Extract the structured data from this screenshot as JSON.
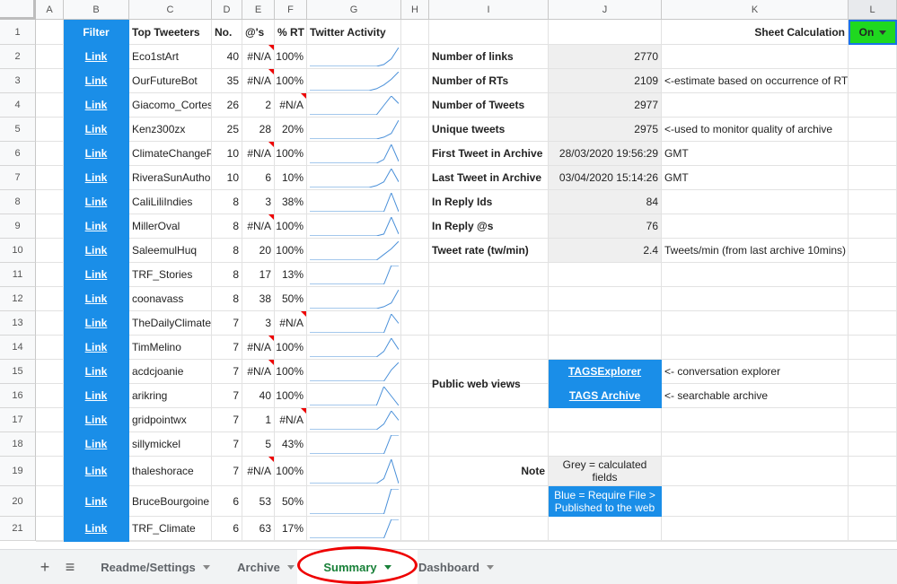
{
  "columns": [
    "A",
    "B",
    "C",
    "D",
    "E",
    "F",
    "G",
    "H",
    "I",
    "J",
    "K",
    "L"
  ],
  "rows": [
    "1",
    "2",
    "3",
    "4",
    "5",
    "6",
    "7",
    "8",
    "9",
    "10",
    "11",
    "12",
    "13",
    "14",
    "15",
    "16",
    "17",
    "18",
    "19",
    "20",
    "21"
  ],
  "header": {
    "filter": "Filter",
    "top_tweeters": "Top Tweeters",
    "no": "No.",
    "ats": "@'s",
    "pct_rt": "% RT",
    "activity": "Twitter Activity",
    "sheet_calc": "Sheet Calculation",
    "sheet_calc_value": "On"
  },
  "tweeters": [
    {
      "link": "Link",
      "name": "Eco1stArt",
      "no": "40",
      "ats": "#N/A",
      "rt": "100%",
      "ats_flag": true,
      "rt_flag": false
    },
    {
      "link": "Link",
      "name": "OurFutureBot",
      "no": "35",
      "ats": "#N/A",
      "rt": "100%",
      "ats_flag": true,
      "rt_flag": false
    },
    {
      "link": "Link",
      "name": "Giacomo_Cortes",
      "no": "26",
      "ats": "2",
      "rt": "#N/A",
      "ats_flag": false,
      "rt_flag": true
    },
    {
      "link": "Link",
      "name": "Kenz300zx",
      "no": "25",
      "ats": "28",
      "rt": "20%",
      "ats_flag": false,
      "rt_flag": false
    },
    {
      "link": "Link",
      "name": "ClimateChangePa",
      "no": "10",
      "ats": "#N/A",
      "rt": "100%",
      "ats_flag": true,
      "rt_flag": false
    },
    {
      "link": "Link",
      "name": "RiveraSunAuthor",
      "no": "10",
      "ats": "6",
      "rt": "10%",
      "ats_flag": false,
      "rt_flag": false
    },
    {
      "link": "Link",
      "name": "CaliLiliIndies",
      "no": "8",
      "ats": "3",
      "rt": "38%",
      "ats_flag": false,
      "rt_flag": false
    },
    {
      "link": "Link",
      "name": "MillerOval",
      "no": "8",
      "ats": "#N/A",
      "rt": "100%",
      "ats_flag": true,
      "rt_flag": false
    },
    {
      "link": "Link",
      "name": "SaleemulHuq",
      "no": "8",
      "ats": "20",
      "rt": "100%",
      "ats_flag": false,
      "rt_flag": false
    },
    {
      "link": "Link",
      "name": "TRF_Stories",
      "no": "8",
      "ats": "17",
      "rt": "13%",
      "ats_flag": false,
      "rt_flag": false
    },
    {
      "link": "Link",
      "name": "coonavass",
      "no": "8",
      "ats": "38",
      "rt": "50%",
      "ats_flag": false,
      "rt_flag": false
    },
    {
      "link": "Link",
      "name": "TheDailyClimate",
      "no": "7",
      "ats": "3",
      "rt": "#N/A",
      "ats_flag": false,
      "rt_flag": true
    },
    {
      "link": "Link",
      "name": "TimMelino",
      "no": "7",
      "ats": "#N/A",
      "rt": "100%",
      "ats_flag": true,
      "rt_flag": false
    },
    {
      "link": "Link",
      "name": "acdcjoanie",
      "no": "7",
      "ats": "#N/A",
      "rt": "100%",
      "ats_flag": true,
      "rt_flag": false
    },
    {
      "link": "Link",
      "name": "arikring",
      "no": "7",
      "ats": "40",
      "rt": "100%",
      "ats_flag": false,
      "rt_flag": false
    },
    {
      "link": "Link",
      "name": "gridpointwx",
      "no": "7",
      "ats": "1",
      "rt": "#N/A",
      "ats_flag": false,
      "rt_flag": true
    },
    {
      "link": "Link",
      "name": "sillymickel",
      "no": "7",
      "ats": "5",
      "rt": "43%",
      "ats_flag": false,
      "rt_flag": false
    },
    {
      "link": "Link",
      "name": "thaleshorace",
      "no": "7",
      "ats": "#N/A",
      "rt": "100%",
      "ats_flag": true,
      "rt_flag": false
    },
    {
      "link": "Link",
      "name": "BruceBourgoine",
      "no": "6",
      "ats": "53",
      "rt": "50%",
      "ats_flag": false,
      "rt_flag": false
    },
    {
      "link": "Link",
      "name": "TRF_Climate",
      "no": "6",
      "ats": "63",
      "rt": "17%",
      "ats_flag": false,
      "rt_flag": false
    }
  ],
  "stats": [
    {
      "label": "Number of links",
      "value": "2770",
      "note": ""
    },
    {
      "label": "Number of RTs",
      "value": "2109",
      "note": "<-estimate based on occurrence of RT"
    },
    {
      "label": "Number of Tweets",
      "value": "2977",
      "note": ""
    },
    {
      "label": "Unique tweets",
      "value": "2975",
      "note": "<-used to monitor quality of archive"
    },
    {
      "label": "First Tweet in Archive",
      "value": "28/03/2020 19:56:29",
      "note": "GMT"
    },
    {
      "label": "Last Tweet in Archive",
      "value": "03/04/2020 15:14:26",
      "note": "GMT"
    },
    {
      "label": "In Reply Ids",
      "value": "84",
      "note": ""
    },
    {
      "label": "In Reply @s",
      "value": "76",
      "note": ""
    },
    {
      "label": "Tweet rate (tw/min)",
      "value": "2.4",
      "note": "Tweets/min (from last archive 10mins)"
    }
  ],
  "public_views": {
    "label": "Public web views",
    "explorer": "TAGSExplorer",
    "explorer_note": "<- conversation explorer",
    "archive": "TAGS Archive",
    "archive_note": "<- searchable archive"
  },
  "note": {
    "label": "Note",
    "grey": "Grey = calculated fields",
    "blue": "Blue = Require File > Published to the web"
  },
  "sparklines": [
    [
      0,
      0,
      0,
      0,
      0,
      0,
      0,
      0,
      0,
      0,
      0.1,
      0.4,
      1
    ],
    [
      0,
      0,
      0,
      0,
      0,
      0,
      0,
      0,
      0,
      0.1,
      0.3,
      0.6,
      1
    ],
    [
      0,
      0,
      0,
      0,
      0,
      0,
      0,
      0,
      0,
      0,
      0.5,
      1,
      0.6
    ],
    [
      0,
      0,
      0,
      0,
      0,
      0,
      0,
      0,
      0,
      0,
      0.1,
      0.3,
      1
    ],
    [
      0,
      0,
      0,
      0,
      0,
      0,
      0,
      0,
      0,
      0,
      0.2,
      1,
      0.1
    ],
    [
      0,
      0,
      0,
      0,
      0,
      0,
      0,
      0,
      0,
      0.1,
      0.3,
      1,
      0.3
    ],
    [
      0,
      0,
      0,
      0,
      0,
      0,
      0,
      0,
      0,
      0,
      0,
      1,
      0
    ],
    [
      0,
      0,
      0,
      0,
      0,
      0,
      0,
      0,
      0,
      0,
      0.1,
      1,
      0.1
    ],
    [
      0,
      0,
      0,
      0,
      0,
      0,
      0,
      0,
      0,
      0,
      0.3,
      0.6,
      1
    ],
    [
      0,
      0,
      0,
      0,
      0,
      0,
      0,
      0,
      0,
      0,
      0,
      1,
      1
    ],
    [
      0,
      0,
      0,
      0,
      0,
      0,
      0,
      0,
      0,
      0,
      0.1,
      0.3,
      1
    ],
    [
      0,
      0,
      0,
      0,
      0,
      0,
      0,
      0,
      0,
      0,
      0,
      1,
      0.5
    ],
    [
      0,
      0,
      0,
      0,
      0,
      0,
      0,
      0,
      0,
      0,
      0.3,
      1,
      0.4
    ],
    [
      0,
      0,
      0,
      0,
      0,
      0,
      0,
      0,
      0,
      0,
      0,
      0.6,
      1
    ],
    [
      0,
      0,
      0,
      0,
      0,
      0,
      0,
      0,
      0,
      0,
      1,
      0.5,
      0
    ],
    [
      0,
      0,
      0,
      0,
      0,
      0,
      0,
      0,
      0,
      0,
      0.3,
      1,
      0.5
    ],
    [
      0,
      0,
      0,
      0,
      0,
      0,
      0,
      0,
      0,
      0,
      0,
      1,
      1
    ],
    [
      0,
      0,
      0,
      0,
      0,
      0,
      0,
      0,
      0,
      0,
      0.2,
      1,
      0
    ],
    [
      0,
      0,
      0,
      0,
      0,
      0,
      0,
      0,
      0,
      0,
      0,
      1,
      1
    ],
    [
      0,
      0,
      0,
      0,
      0,
      0,
      0,
      0,
      0,
      0,
      0,
      1,
      1
    ]
  ],
  "tabs": [
    {
      "label": "Readme/Settings",
      "active": false
    },
    {
      "label": "Archive",
      "active": false
    },
    {
      "label": "Summary",
      "active": true
    },
    {
      "label": "Dashboard",
      "active": false
    }
  ],
  "tabbar": {
    "add": "+",
    "menu": "≡"
  },
  "colors": {
    "accent_blue": "#1a8ee8",
    "toggle_green": "#1fd81f",
    "active_tab": "#188038",
    "sparkline": "#4a90d9",
    "annotation": "#e00000"
  }
}
